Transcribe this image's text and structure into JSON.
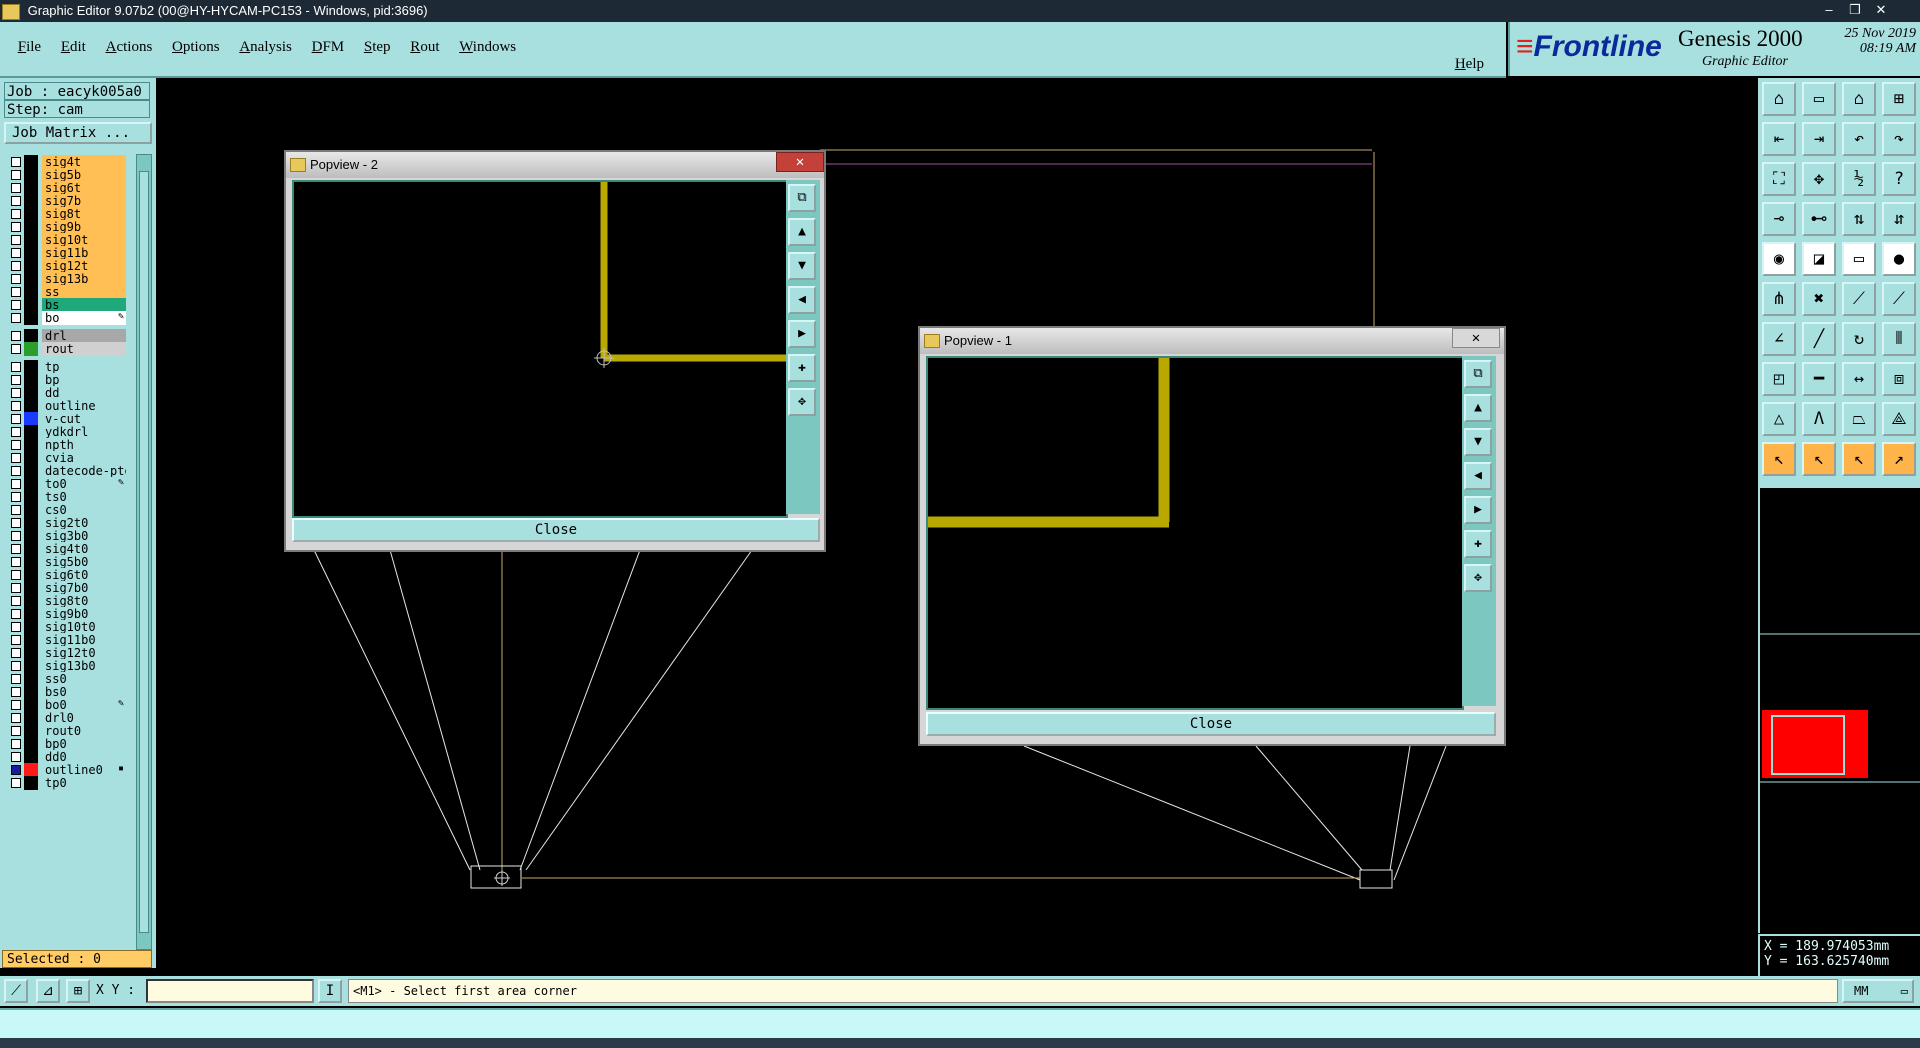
{
  "window": {
    "title": "Graphic Editor 9.07b2 (00@HY-HYCAM-PC153 - Windows, pid:3696)"
  },
  "menu": {
    "items": [
      "File",
      "Edit",
      "Actions",
      "Options",
      "Analysis",
      "DFM",
      "Step",
      "Rout",
      "Windows"
    ],
    "help": "Help"
  },
  "brand": {
    "logo": "Frontline",
    "product": "Genesis 2000",
    "subtitle": "Graphic Editor",
    "date": "25 Nov 2019",
    "time": "08:19 AM"
  },
  "job": {
    "job_line": "Job : eacyk005a0",
    "step_line": "Step: cam",
    "matrix_button": "Job Matrix ..."
  },
  "layers": [
    {
      "name": "sig4t",
      "bg": "#ffbf55",
      "sw": "#000000"
    },
    {
      "name": "sig5b",
      "bg": "#ffbf55",
      "sw": "#000000"
    },
    {
      "name": "sig6t",
      "bg": "#ffbf55",
      "sw": "#000000"
    },
    {
      "name": "sig7b",
      "bg": "#ffbf55",
      "sw": "#000000"
    },
    {
      "name": "sig8t",
      "bg": "#ffbf55",
      "sw": "#000000"
    },
    {
      "name": "sig9b",
      "bg": "#ffbf55",
      "sw": "#000000"
    },
    {
      "name": "sig10t",
      "bg": "#ffbf55",
      "sw": "#000000"
    },
    {
      "name": "sig11b",
      "bg": "#ffbf55",
      "sw": "#000000"
    },
    {
      "name": "sig12t",
      "bg": "#ffbf55",
      "sw": "#000000"
    },
    {
      "name": "sig13b",
      "bg": "#ffbf55",
      "sw": "#000000"
    },
    {
      "name": "ss",
      "bg": "#ffbf55",
      "sw": "#000000"
    },
    {
      "name": "bs",
      "bg": "#1fa87a",
      "sw": "#000000"
    },
    {
      "name": "bo",
      "bg": "#ffffff",
      "sw": "#000000",
      "mark": "✎"
    },
    {
      "gap": true
    },
    {
      "name": "drl",
      "bg": "#a8a8a8",
      "sw": "#000000"
    },
    {
      "name": "rout",
      "bg": "#d0d0d0",
      "sw": "#2aa02a"
    },
    {
      "gap": true
    },
    {
      "name": "tp",
      "bg": "#a8e0e0",
      "sw": "#000000"
    },
    {
      "name": "bp",
      "bg": "#a8e0e0",
      "sw": "#000000"
    },
    {
      "name": "dd",
      "bg": "#a8e0e0",
      "sw": "#000000"
    },
    {
      "name": "outline",
      "bg": "#a8e0e0",
      "sw": "#000000"
    },
    {
      "name": "v-cut",
      "bg": "#a8e0e0",
      "sw": "#1a3aff"
    },
    {
      "name": "ydkdrl",
      "bg": "#a8e0e0",
      "sw": "#000000"
    },
    {
      "name": "npth",
      "bg": "#a8e0e0",
      "sw": "#000000"
    },
    {
      "name": "cvia",
      "bg": "#a8e0e0",
      "sw": "#000000"
    },
    {
      "name": "datecode-pto",
      "bg": "#a8e0e0",
      "sw": "#000000"
    },
    {
      "name": "to0",
      "bg": "#a8e0e0",
      "sw": "#000000",
      "mark": "✎"
    },
    {
      "name": "ts0",
      "bg": "#a8e0e0",
      "sw": "#000000"
    },
    {
      "name": "cs0",
      "bg": "#a8e0e0",
      "sw": "#000000"
    },
    {
      "name": "sig2t0",
      "bg": "#a8e0e0",
      "sw": "#000000"
    },
    {
      "name": "sig3b0",
      "bg": "#a8e0e0",
      "sw": "#000000"
    },
    {
      "name": "sig4t0",
      "bg": "#a8e0e0",
      "sw": "#000000"
    },
    {
      "name": "sig5b0",
      "bg": "#a8e0e0",
      "sw": "#000000"
    },
    {
      "name": "sig6t0",
      "bg": "#a8e0e0",
      "sw": "#000000"
    },
    {
      "name": "sig7b0",
      "bg": "#a8e0e0",
      "sw": "#000000"
    },
    {
      "name": "sig8t0",
      "bg": "#a8e0e0",
      "sw": "#000000"
    },
    {
      "name": "sig9b0",
      "bg": "#a8e0e0",
      "sw": "#000000"
    },
    {
      "name": "sig10t0",
      "bg": "#a8e0e0",
      "sw": "#000000"
    },
    {
      "name": "sig11b0",
      "bg": "#a8e0e0",
      "sw": "#000000"
    },
    {
      "name": "sig12t0",
      "bg": "#a8e0e0",
      "sw": "#000000"
    },
    {
      "name": "sig13b0",
      "bg": "#a8e0e0",
      "sw": "#000000"
    },
    {
      "name": "ss0",
      "bg": "#a8e0e0",
      "sw": "#000000"
    },
    {
      "name": "bs0",
      "bg": "#a8e0e0",
      "sw": "#000000"
    },
    {
      "name": "bo0",
      "bg": "#a8e0e0",
      "sw": "#000000",
      "mark": "✎"
    },
    {
      "name": "drl0",
      "bg": "#a8e0e0",
      "sw": "#000000"
    },
    {
      "name": "rout0",
      "bg": "#a8e0e0",
      "sw": "#000000"
    },
    {
      "name": "bp0",
      "bg": "#a8e0e0",
      "sw": "#000000"
    },
    {
      "name": "dd0",
      "bg": "#a8e0e0",
      "sw": "#000000"
    },
    {
      "name": "outline0",
      "bg": "#a8e0e0",
      "sw": "#ff1a1a",
      "chk": "#1a1aa0",
      "mark": "▪"
    },
    {
      "name": "tp0",
      "bg": "#a8e0e0",
      "sw": "#000000"
    }
  ],
  "selected": "Selected : 0",
  "popviews": [
    {
      "title": "Popview - 2",
      "close_label": "Close"
    },
    {
      "title": "Popview - 1",
      "close_label": "Close"
    }
  ],
  "coords": {
    "x_line": "X = 189.974053mm",
    "y_line": "Y = 163.625740mm"
  },
  "status": {
    "xy_label": "X Y :",
    "xy_value": "",
    "prompt": "<M1> - Select first area corner",
    "units": "MM"
  },
  "colors": {
    "panel": "#a8e0e0",
    "trace": "#b8a800",
    "overview_red": "#ff0000"
  }
}
